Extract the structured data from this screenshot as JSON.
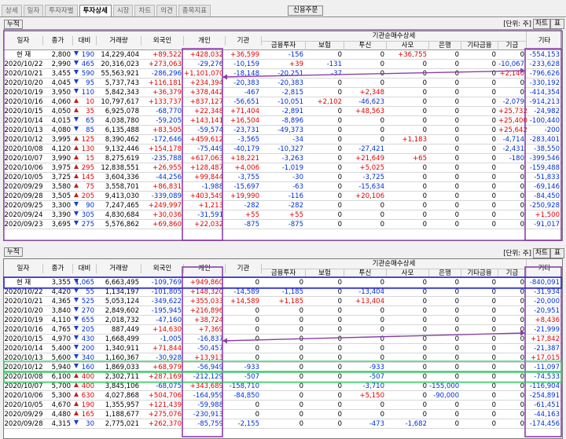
{
  "tabs": [
    {
      "label": "상세"
    },
    {
      "label": "일자"
    },
    {
      "label": "투자자별"
    },
    {
      "label": "투자상세",
      "active": true
    },
    {
      "label": "시장"
    },
    {
      "label": "차트"
    },
    {
      "label": "의견"
    },
    {
      "label": "종목지표"
    }
  ],
  "credit_order_label": "신용주문",
  "accum_label": "누적",
  "unit_label": "[단위: 주]",
  "chart_button": "차트",
  "table_button": "표",
  "colors": {
    "red": "#e00000",
    "blue": "#0030d0",
    "box_purple": "#8a3fa8",
    "box_blue": "#2a2ad0",
    "box_green": "#3cc86a"
  },
  "headers": {
    "date": "일자",
    "close": "종가",
    "change": "대비",
    "volume": "거래량",
    "foreign": "외국인",
    "individual": "개인",
    "institution": "기관",
    "inst_detail": "기관순매수상세",
    "financial_invest": "금융투자",
    "insurance": "보험",
    "trust": "투신",
    "private": "사모",
    "bank": "은행",
    "other_finance": "기타금융",
    "pension": "기금",
    "other": "기타"
  },
  "top_rows": [
    [
      "현   재",
      "2,800",
      "d",
      "190",
      "14,229,404",
      "+89,522",
      "+428,032",
      "+36,599",
      "-156",
      "0",
      "0",
      "+36,755",
      "0",
      "0",
      "0",
      "-554,153"
    ],
    [
      "2020/10/22",
      "2,990",
      "d",
      "465",
      "20,316,023",
      "+273,063",
      "-29,276",
      "-10,159",
      "+39",
      "-131",
      "0",
      "0",
      "0",
      "0",
      "-10,067",
      "-233,628"
    ],
    [
      "2020/10/21",
      "3,455",
      "d",
      "590",
      "55,563,921",
      "-286,296",
      "+1,101,070",
      "-18,148",
      "-20,251",
      "-37",
      "0",
      "0",
      "0",
      "0",
      "+2,140",
      "-796,626"
    ],
    [
      "2020/10/20",
      "4,045",
      "d",
      "95",
      "5,737,743",
      "+116,181",
      "+234,394",
      "-20,383",
      "-20,383",
      "0",
      "0",
      "0",
      "0",
      "0",
      "0",
      "-330,192"
    ],
    [
      "2020/10/19",
      "3,950",
      "d",
      "110",
      "5,842,343",
      "+36,379",
      "+378,442",
      "-467",
      "-2,815",
      "0",
      "+2,348",
      "0",
      "0",
      "0",
      "0",
      "-414,354"
    ],
    [
      "2020/10/16",
      "4,060",
      "u",
      "10",
      "10,797,617",
      "+133,737",
      "+837,127",
      "-56,651",
      "-10,051",
      "+2,102",
      "-46,623",
      "0",
      "0",
      "0",
      "-2,079",
      "-914,213"
    ],
    [
      "2020/10/15",
      "4,050",
      "u",
      "35",
      "6,925,078",
      "-68,770",
      "+22,348",
      "+71,404",
      "-2,891",
      "0",
      "+48,563",
      "0",
      "0",
      "0",
      "+25,732",
      "-24,982"
    ],
    [
      "2020/10/14",
      "4,015",
      "d",
      "65",
      "4,038,780",
      "-59,205",
      "+143,141",
      "+16,504",
      "-8,896",
      "0",
      "0",
      "0",
      "0",
      "0",
      "+25,400",
      "-100,440"
    ],
    [
      "2020/10/13",
      "4,080",
      "d",
      "85",
      "6,135,488",
      "+83,505",
      "-59,574",
      "-23,731",
      "-49,373",
      "0",
      "0",
      "0",
      "0",
      "0",
      "+25,642",
      "-200"
    ],
    [
      "2020/10/12",
      "3,995",
      "u",
      "125",
      "8,390,462",
      "-172,646",
      "+459,612",
      "-3,565",
      "-34",
      "0",
      "0",
      "+1,183",
      "0",
      "0",
      "-4,714",
      "-283,401"
    ],
    [
      "2020/10/08",
      "4,120",
      "u",
      "130",
      "9,132,446",
      "+154,178",
      "-75,449",
      "-40,179",
      "-10,327",
      "0",
      "-27,421",
      "0",
      "0",
      "0",
      "-2,431",
      "-38,550"
    ],
    [
      "2020/10/07",
      "3,990",
      "u",
      "15",
      "8,275,619",
      "-235,788",
      "+617,063",
      "+18,221",
      "-3,263",
      "0",
      "+21,649",
      "+65",
      "0",
      "0",
      "-180",
      "-399,546"
    ],
    [
      "2020/10/06",
      "3,975",
      "u",
      "295",
      "12,838,551",
      "+26,955",
      "+128,487",
      "+4,006",
      "-1,019",
      "0",
      "+5,025",
      "0",
      "0",
      "0",
      "0",
      "-159,488"
    ],
    [
      "2020/10/05",
      "3,725",
      "u",
      "145",
      "3,604,336",
      "-44,256",
      "+99,844",
      "-3,755",
      "-30",
      "0",
      "-3,725",
      "0",
      "0",
      "0",
      "0",
      "-51,833"
    ],
    [
      "2020/09/29",
      "3,580",
      "u",
      "75",
      "3,558,701",
      "+86,831",
      "-1,988",
      "-15,697",
      "-63",
      "0",
      "-15,634",
      "0",
      "0",
      "0",
      "0",
      "-69,146"
    ],
    [
      "2020/09/28",
      "3,505",
      "u",
      "205",
      "9,413,030",
      "-339,089",
      "+403,549",
      "+19,990",
      "-116",
      "0",
      "+20,106",
      "0",
      "0",
      "0",
      "0",
      "-84,450"
    ],
    [
      "2020/09/25",
      "3,300",
      "d",
      "90",
      "7,247,465",
      "+249,997",
      "+1,213",
      "-282",
      "-282",
      "0",
      "0",
      "0",
      "0",
      "0",
      "0",
      "-250,928"
    ],
    [
      "2020/09/24",
      "3,390",
      "d",
      "305",
      "4,830,684",
      "+30,036",
      "-31,591",
      "+55",
      "+55",
      "0",
      "0",
      "0",
      "0",
      "0",
      "0",
      "+1,500"
    ],
    [
      "2020/09/23",
      "3,695",
      "d",
      "275",
      "5,576,862",
      "+69,860",
      "+22,032",
      "-875",
      "-875",
      "0",
      "0",
      "0",
      "0",
      "0",
      "0",
      "-91,017"
    ]
  ],
  "bottom_rows": [
    [
      "현   재",
      "3,355",
      "d",
      "1,065",
      "6,663,495",
      "-109,769",
      "+949,860",
      "0",
      "0",
      "0",
      "0",
      "0",
      "0",
      "0",
      "0",
      "-840,091"
    ],
    [
      "2020/10/22",
      "4,420",
      "d",
      "55",
      "1,134,197",
      "-101,805",
      "+148,320",
      "-14,589",
      "-1,185",
      "0",
      "-13,404",
      "0",
      "0",
      "0",
      "0",
      "-31,934"
    ],
    [
      "2020/10/21",
      "4,365",
      "d",
      "525",
      "5,053,124",
      "-349,622",
      "+355,033",
      "+14,589",
      "+1,185",
      "0",
      "+13,404",
      "0",
      "0",
      "0",
      "0",
      "-20,000"
    ],
    [
      "2020/10/20",
      "3,840",
      "d",
      "270",
      "2,849,602",
      "-195,945",
      "+216,896",
      "0",
      "0",
      "0",
      "0",
      "0",
      "0",
      "0",
      "0",
      "-20,951"
    ],
    [
      "2020/10/19",
      "4,110",
      "d",
      "655",
      "2,018,732",
      "-47,160",
      "+38,724",
      "0",
      "0",
      "0",
      "0",
      "0",
      "0",
      "0",
      "0",
      "+8,436"
    ],
    [
      "2020/10/16",
      "4,765",
      "d",
      "205",
      "887,449",
      "+14,630",
      "+7,369",
      "0",
      "0",
      "0",
      "0",
      "0",
      "0",
      "0",
      "0",
      "-21,999"
    ],
    [
      "2020/10/15",
      "4,970",
      "d",
      "430",
      "1,668,499",
      "-1,005",
      "-16,837",
      "0",
      "0",
      "0",
      "0",
      "0",
      "0",
      "0",
      "0",
      "+17,842"
    ],
    [
      "2020/10/14",
      "5,400",
      "d",
      "200",
      "1,340,911",
      "+71,844",
      "-50,457",
      "0",
      "0",
      "0",
      "0",
      "0",
      "0",
      "0",
      "0",
      "-21,387"
    ],
    [
      "2020/10/13",
      "5,600",
      "d",
      "340",
      "1,160,367",
      "-30,928",
      "+13,913",
      "0",
      "0",
      "0",
      "0",
      "0",
      "0",
      "0",
      "0",
      "+17,015"
    ],
    [
      "2020/10/12",
      "5,940",
      "d",
      "160",
      "1,869,033",
      "+68,979",
      "-56,949",
      "-933",
      "0",
      "0",
      "-933",
      "0",
      "0",
      "0",
      "0",
      "-11,097"
    ],
    [
      "2020/10/08",
      "6,100",
      "u",
      "400",
      "2,302,711",
      "+287,169",
      "-212,129",
      "-507",
      "0",
      "0",
      "-507",
      "0",
      "0",
      "0",
      "0",
      "-74,533"
    ],
    [
      "2020/10/07",
      "5,700",
      "u",
      "400",
      "3,845,106",
      "-68,075",
      "+343,689",
      "-158,710",
      "0",
      "0",
      "-3,710",
      "0",
      "-155,000",
      "0",
      "0",
      "-116,904"
    ],
    [
      "2020/10/06",
      "5,300",
      "u",
      "630",
      "4,027,868",
      "+504,706",
      "-164,959",
      "-84,850",
      "0",
      "0",
      "+5,150",
      "0",
      "-90,000",
      "0",
      "0",
      "-254,891"
    ],
    [
      "2020/10/05",
      "4,670",
      "u",
      "190",
      "1,355,957",
      "+121,439",
      "-59,988",
      "0",
      "0",
      "0",
      "0",
      "0",
      "0",
      "0",
      "0",
      "-61,451"
    ],
    [
      "2020/09/29",
      "4,480",
      "u",
      "165",
      "1,188,677",
      "+275,076",
      "-230,913",
      "0",
      "0",
      "0",
      "0",
      "0",
      "0",
      "0",
      "0",
      "-44,163"
    ],
    [
      "2020/09/28",
      "4,315",
      "d",
      "30",
      "2,775,021",
      "+262,370",
      "-85,759",
      "-2,155",
      "0",
      "0",
      "-473",
      "-1,682",
      "0",
      "0",
      "0",
      "-174,456"
    ]
  ]
}
